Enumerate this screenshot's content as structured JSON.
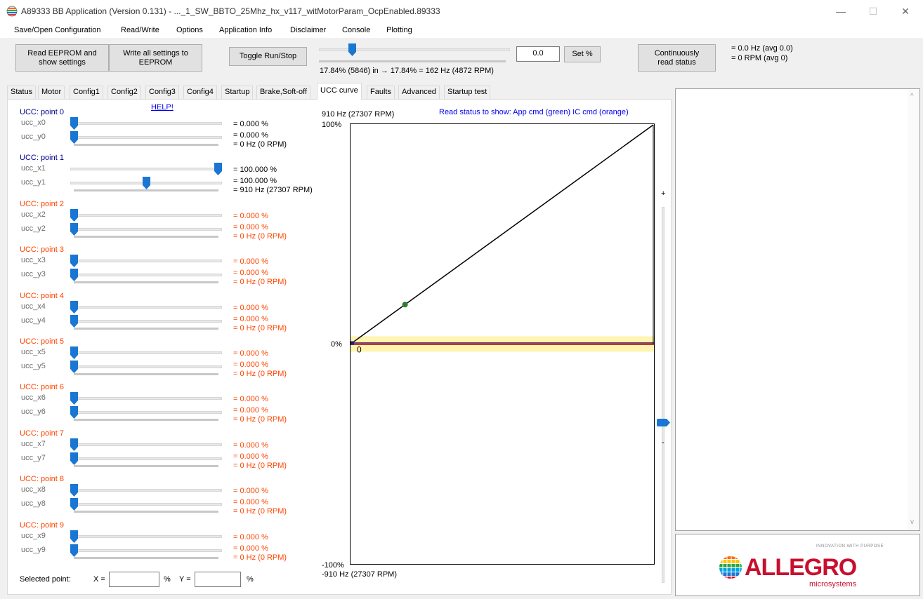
{
  "window": {
    "title": "A89333 BB Application (Version 0.131)  -  ..._1_SW_BBTO_25Mhz_hx_v117_witMotorParam_OcpEnabled.89333",
    "minimize": "—",
    "maximize": "☐",
    "close": "✕"
  },
  "menu": [
    "Save/Open Configuration",
    "Read/Write",
    "Options",
    "Application Info",
    "Disclaimer",
    "Console",
    "Plotting"
  ],
  "toolbar": {
    "read_eeprom": "Read EEPROM and\nshow settings",
    "write_eeprom": "Write all settings to\nEEPROM",
    "toggle_run": "Toggle Run/Stop",
    "speed_percent": 17.84,
    "speed_text": "17.84% (5846) in → 17.84% = 162 Hz (4872 RPM)",
    "set_value": "0.0",
    "set_button": "Set %",
    "continuous_read": "Continuously\nread status",
    "status_hz": "= 0.0 Hz (avg 0.0)",
    "status_rpm": "= 0 RPM (avg 0)"
  },
  "tabs": [
    "Status",
    "Motor",
    "Config1",
    "Config2",
    "Config3",
    "Config4",
    "Startup",
    "Brake,Soft-off",
    "UCC curve",
    "Faults",
    "Advanced",
    "Startup test"
  ],
  "active_tab": "UCC curve",
  "help_link": "HELP!",
  "points": [
    {
      "label": "UCC: point 0",
      "color": "blue",
      "x_label": "ucc_x0",
      "y_label": "ucc_y0",
      "x_val": "= 0.000 %",
      "y_val": "= 0.000 %",
      "freq": "= 0 Hz (0 RPM)",
      "x_pos": 0,
      "y_pos": 0
    },
    {
      "label": "UCC: point 1",
      "color": "blue",
      "x_label": "ucc_x1",
      "y_label": "ucc_y1",
      "x_val": "= 100.000 %",
      "y_val": "= 100.000 %",
      "freq": "= 910 Hz (27307 RPM)",
      "x_pos": 1,
      "y_pos": 0.5
    },
    {
      "label": "UCC: point 2",
      "color": "orange",
      "x_label": "ucc_x2",
      "y_label": "ucc_y2",
      "x_val": "= 0.000 %",
      "y_val": "= 0.000 %",
      "freq": "= 0 Hz (0 RPM)",
      "x_pos": 0,
      "y_pos": 0
    },
    {
      "label": "UCC: point 3",
      "color": "orange",
      "x_label": "ucc_x3",
      "y_label": "ucc_y3",
      "x_val": "= 0.000 %",
      "y_val": "= 0.000 %",
      "freq": "= 0 Hz (0 RPM)",
      "x_pos": 0,
      "y_pos": 0
    },
    {
      "label": "UCC: point 4",
      "color": "orange",
      "x_label": "ucc_x4",
      "y_label": "ucc_y4",
      "x_val": "= 0.000 %",
      "y_val": "= 0.000 %",
      "freq": "= 0 Hz (0 RPM)",
      "x_pos": 0,
      "y_pos": 0
    },
    {
      "label": "UCC: point 5",
      "color": "orange",
      "x_label": "ucc_x5",
      "y_label": "ucc_y5",
      "x_val": "= 0.000 %",
      "y_val": "= 0.000 %",
      "freq": "= 0 Hz (0 RPM)",
      "x_pos": 0,
      "y_pos": 0
    },
    {
      "label": "UCC: point 6",
      "color": "orange",
      "x_label": "ucc_x6",
      "y_label": "ucc_y6",
      "x_val": "= 0.000 %",
      "y_val": "= 0.000 %",
      "freq": "= 0 Hz (0 RPM)",
      "x_pos": 0,
      "y_pos": 0
    },
    {
      "label": "UCC: point 7",
      "color": "orange",
      "x_label": "ucc_x7",
      "y_label": "ucc_y7",
      "x_val": "= 0.000 %",
      "y_val": "= 0.000 %",
      "freq": "= 0 Hz (0 RPM)",
      "x_pos": 0,
      "y_pos": 0
    },
    {
      "label": "UCC: point 8",
      "color": "orange",
      "x_label": "ucc_x8",
      "y_label": "ucc_y8",
      "x_val": "= 0.000 %",
      "y_val": "= 0.000 %",
      "freq": "= 0 Hz (0 RPM)",
      "x_pos": 0,
      "y_pos": 0
    },
    {
      "label": "UCC: point 9",
      "color": "orange",
      "x_label": "ucc_x9",
      "y_label": "ucc_y9",
      "x_val": "= 0.000 %",
      "y_val": "= 0.000 %",
      "freq": "= 0 Hz (0 RPM)",
      "x_pos": 0,
      "y_pos": 0
    }
  ],
  "selected": {
    "label": "Selected point:",
    "x_label": "X =",
    "y_label": "Y =",
    "percent": "%",
    "x_value": "",
    "y_value": ""
  },
  "chart": {
    "top_freq": "910 Hz (27307 RPM)",
    "bottom_freq": "-910 Hz (27307 RPM)",
    "legend_note": "Read status to show: App cmd (green) IC cmd (orange)",
    "y_top": "100%",
    "y_zero": "0%",
    "y_bottom": "-100%",
    "zero_marker": "0",
    "plus": "+",
    "minus": "-",
    "curve_points": [
      [
        0,
        0
      ],
      [
        100,
        100
      ]
    ],
    "green_point": [
      18,
      18
    ],
    "zoom_level": 0.25
  },
  "logo": {
    "tagline": "INNOVATION WITH PURPOSE",
    "brand": "ALLEGRO",
    "sub": "microsystems"
  },
  "colors": {
    "blue_label": "#00008b",
    "orange_label": "#ff4500",
    "link": "#0000ee",
    "slider_thumb": "#1976d2",
    "logo_red": "#c8102e"
  }
}
